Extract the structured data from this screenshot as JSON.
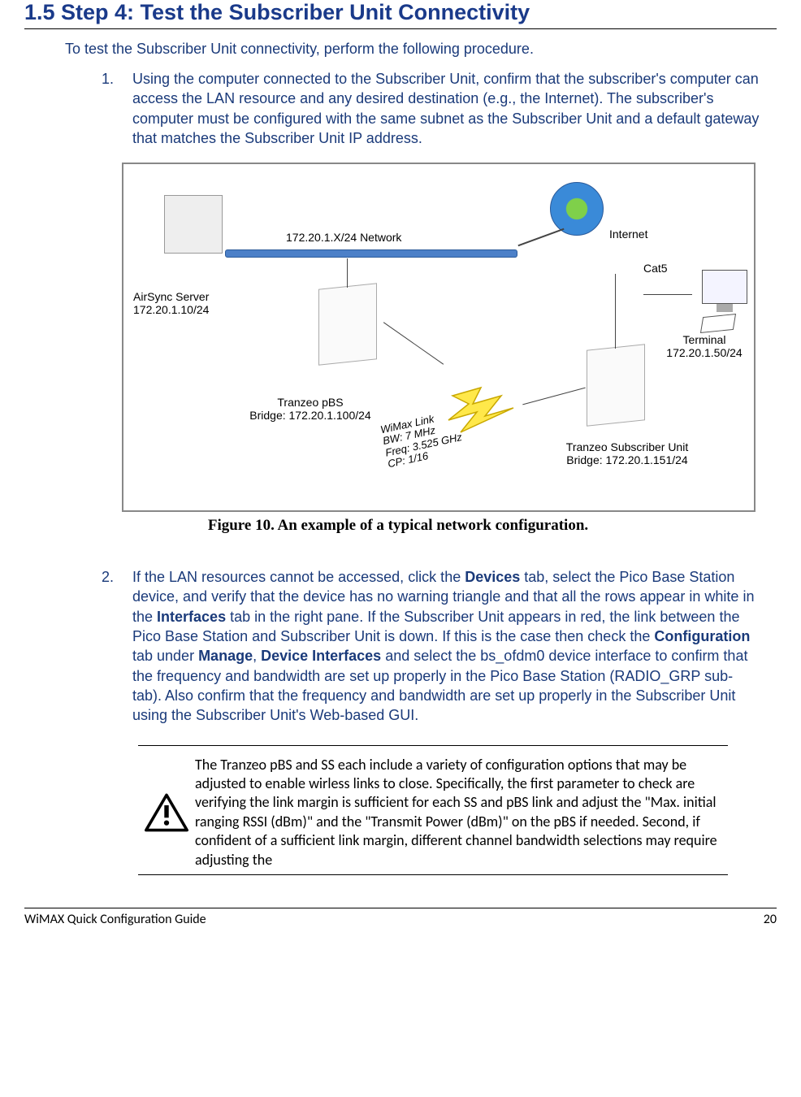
{
  "heading": "1.5 Step 4: Test the Subscriber Unit Connectivity",
  "intro": "To test the Subscriber Unit connectivity, perform the following procedure.",
  "list": {
    "item1_num": "1.",
    "item1_text": "Using the computer connected to the Subscriber Unit, confirm that the subscriber's computer can access the LAN resource and any desired destination (e.g., the Internet). The subscriber's computer must be configured with the same subnet as the Subscriber Unit and a default gateway that matches the Subscriber Unit IP address.",
    "item2_num": "2.",
    "item2_a": "If the LAN resources cannot be accessed, click the ",
    "item2_b": "Devices",
    "item2_c": " tab, select the Pico Base Station device, and verify that the device has no warning triangle and that all the rows appear in white in the ",
    "item2_d": "Interfaces",
    "item2_e": " tab in the right pane. If the Subscriber Unit appears in red, the link between the Pico Base Station and Subscriber Unit is down. If this is the case then check the ",
    "item2_f": "Configuration",
    "item2_g": " tab under ",
    "item2_h": "Manage",
    "item2_i": ", ",
    "item2_j": "Device Interfaces",
    "item2_k": " and select the bs_ofdm0 device interface to confirm that the frequency and bandwidth are set up properly in the Pico Base Station (RADIO_GRP sub-tab). Also confirm that the frequency and bandwidth are set up properly in the Subscriber Unit using the Subscriber Unit's Web-based GUI."
  },
  "figure": {
    "net_label": "172.20.1.X/24 Network",
    "internet": "Internet",
    "airsync": "AirSync Server\n172.20.1.10/24",
    "pbs": "Tranzeo pBS\nBridge: 172.20.1.100/24",
    "su": "Tranzeo Subscriber Unit\nBridge: 172.20.1.151/24",
    "terminal": "Terminal\n172.20.1.50/24",
    "cat5": "Cat5",
    "wimax": "WiMax Link\nBW: 7 MHz\nFreq: 3.525 GHz\nCP: 1/16"
  },
  "caption": "Figure 10. An example of a typical network configuration.",
  "note": "The Tranzeo pBS and SS each include a variety of configuration options that may be adjusted to enable wirless links to close. Specifically, the first parameter to check are verifying the link margin is sufficient for each SS and pBS link and adjust the \"Max. initial ranging RSSI (dBm)\" and the \"Transmit Power (dBm)\" on the pBS if needed. Second, if confident of a sufficient link margin, different channel bandwidth selections may require adjusting the",
  "footer": {
    "left": "WiMAX Quick Configuration Guide",
    "right": "20"
  }
}
